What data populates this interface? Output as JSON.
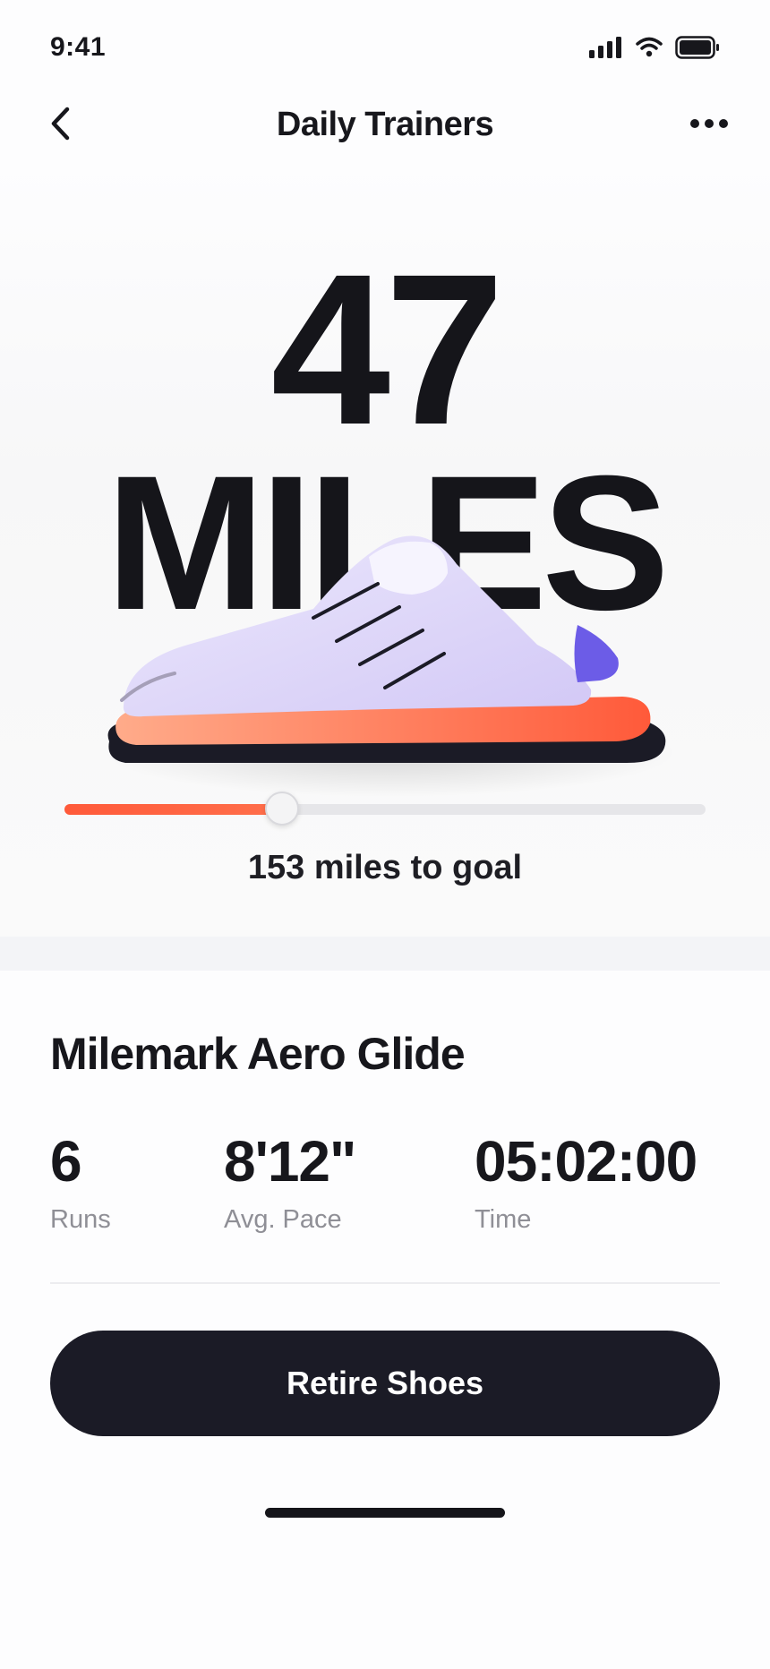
{
  "status_bar": {
    "time": "9:41",
    "icons": [
      "cellular-signal-icon",
      "wifi-icon",
      "battery-icon"
    ]
  },
  "nav": {
    "title": "Daily Trainers",
    "back_icon": "chevron-left-icon",
    "more_icon": "more-horizontal-icon"
  },
  "hero": {
    "mileage_value": "47",
    "mileage_unit": "MILES",
    "shoe_image": "running-shoe-illustration",
    "progress": {
      "fraction": 0.34,
      "goal_text": "153 miles to goal",
      "fill_color": "#ff5a3a"
    }
  },
  "product": {
    "name": "Milemark Aero Glide"
  },
  "stats": [
    {
      "value": "6",
      "label": "Runs"
    },
    {
      "value": "8'12\"",
      "label": "Avg. Pace"
    },
    {
      "value": "05:02:00",
      "label": "Time"
    }
  ],
  "actions": {
    "retire_label": "Retire Shoes"
  },
  "colors": {
    "accent": "#ff5a3a",
    "button_bg": "#1b1b26",
    "shoe_upper": "#ddd6f8",
    "shoe_heel": "#6c5ce7"
  }
}
